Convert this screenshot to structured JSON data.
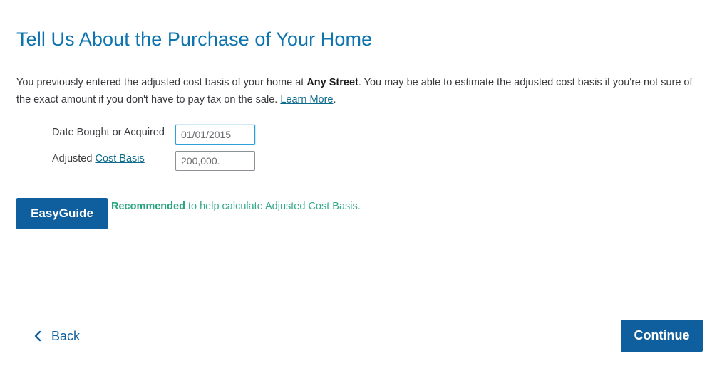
{
  "page": {
    "title": "Tell Us About the Purchase of Your Home"
  },
  "intro": {
    "text_before": "You previously entered the adjusted cost basis of your home at ",
    "address": "Any Street",
    "text_after": ". You may be able to estimate the adjusted cost basis if you're not sure of the exact amount if you don't have to pay tax on the sale. ",
    "learn_more_link": "Learn More",
    "trailing": "."
  },
  "form": {
    "date_label": "Date Bought or Acquired",
    "date_value": "01/01/2015",
    "basis_label_prefix": "Adjusted ",
    "basis_label_link": "Cost Basis",
    "basis_value": "200,000."
  },
  "easyguide": {
    "button_label": "EasyGuide",
    "recommended": "Recommended",
    "help_text": " to help calculate Adjusted Cost Basis."
  },
  "footer": {
    "back_label": "Back",
    "back_icon": "chevron-left-icon",
    "continue_label": "Continue"
  },
  "colors": {
    "title": "#0d74af",
    "primary_button": "#0f5f9e",
    "recommend_green": "#2aa57f",
    "link": "#0d6b8c"
  }
}
